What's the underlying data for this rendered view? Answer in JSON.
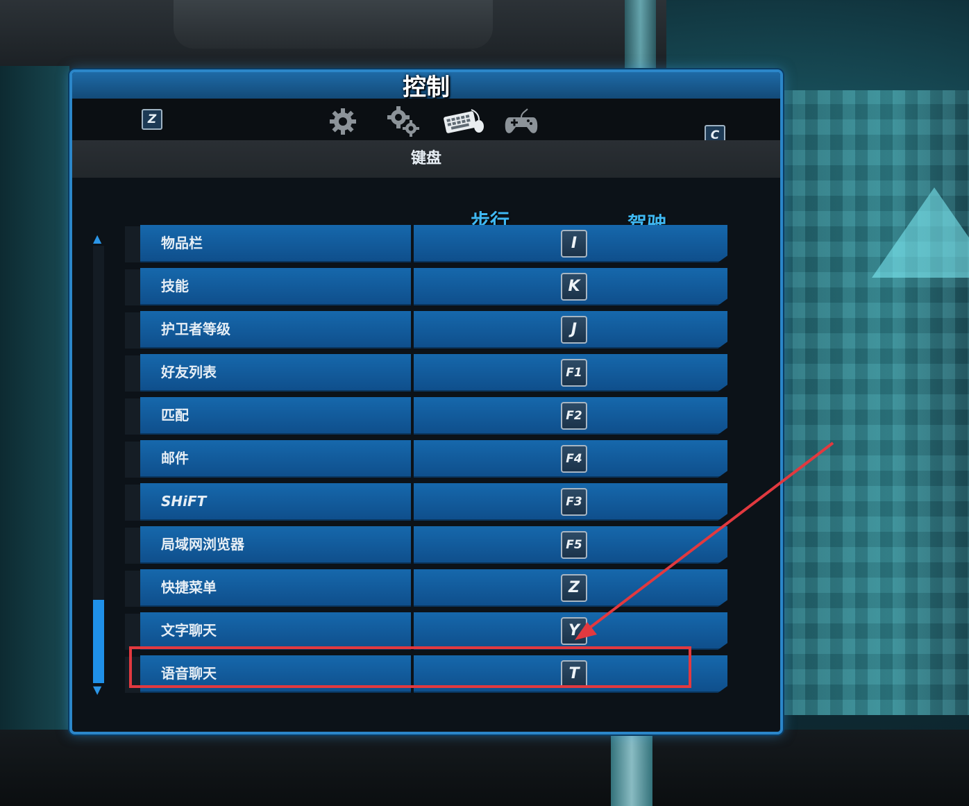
{
  "window": {
    "title": "控制",
    "prev_key": "Z",
    "next_key": "C"
  },
  "tabs": [
    {
      "icon": "gear-icon"
    },
    {
      "icon": "gears-icon"
    },
    {
      "icon": "keyboard-mouse-icon",
      "active": true
    },
    {
      "icon": "gamepad-icon"
    }
  ],
  "section_title": "键盘",
  "columns": {
    "walk": "步行",
    "drive": "驾驶"
  },
  "bindings": [
    {
      "action": "物品栏",
      "key": "I"
    },
    {
      "action": "技能",
      "key": "K"
    },
    {
      "action": "护卫者等级",
      "key": "J"
    },
    {
      "action": "好友列表",
      "key": "F1"
    },
    {
      "action": "匹配",
      "key": "F2"
    },
    {
      "action": "邮件",
      "key": "F4"
    },
    {
      "action": "SHiFT",
      "key": "F3"
    },
    {
      "action": "局域网浏览器",
      "key": "F5"
    },
    {
      "action": "快捷菜单",
      "key": "Z"
    },
    {
      "action": "文字聊天",
      "key": "Y"
    },
    {
      "action": "语音聊天",
      "key": "T",
      "highlighted": true
    }
  ],
  "colors": {
    "accent": "#2b86c9",
    "row": "#1668ac",
    "column_header": "#3fb8f2",
    "annotation": "#e2393f"
  }
}
